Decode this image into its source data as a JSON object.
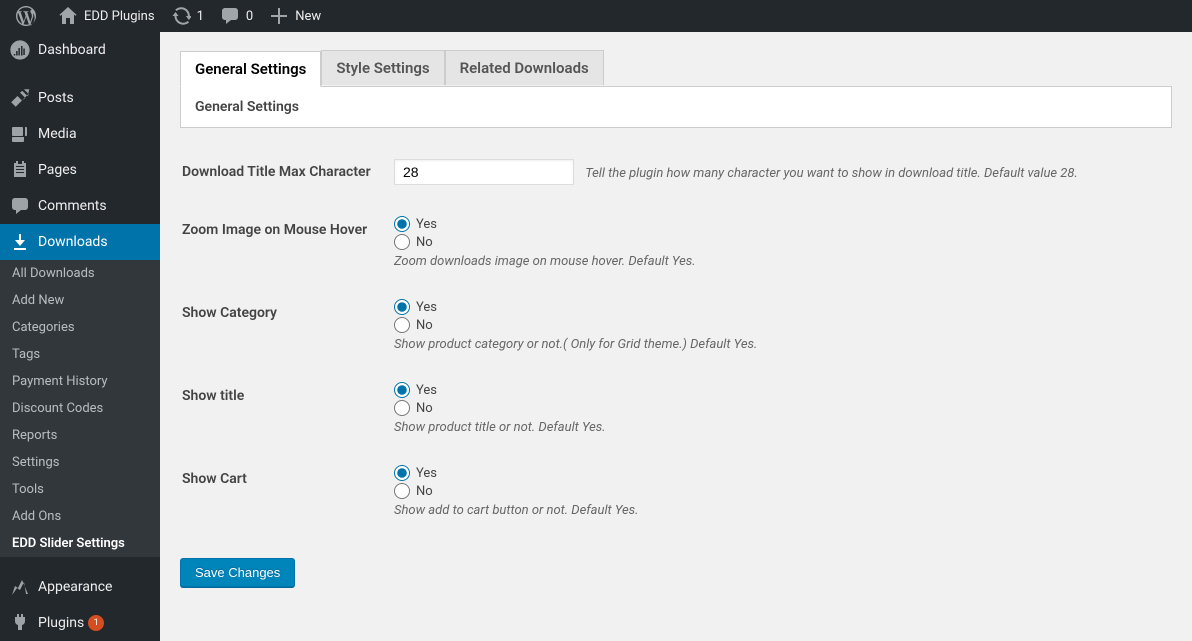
{
  "adminbar": {
    "site_name": "EDD Plugins",
    "updates_count": "1",
    "comments_count": "0",
    "new_label": "New"
  },
  "sidebar": {
    "dashboard": "Dashboard",
    "posts": "Posts",
    "media": "Media",
    "pages": "Pages",
    "comments": "Comments",
    "downloads": "Downloads",
    "downloads_sub": {
      "all": "All Downloads",
      "add_new": "Add New",
      "categories": "Categories",
      "tags": "Tags",
      "payment_history": "Payment History",
      "discount_codes": "Discount Codes",
      "reports": "Reports",
      "settings": "Settings",
      "tools": "Tools",
      "addons": "Add Ons",
      "edd_slider": "EDD Slider Settings"
    },
    "appearance": "Appearance",
    "plugins": "Plugins",
    "plugins_badge": "1"
  },
  "tabs": {
    "general": "General Settings",
    "style": "Style Settings",
    "related": "Related Downloads"
  },
  "panel_title": "General Settings",
  "fields": {
    "maxchar": {
      "label": "Download Title Max Character",
      "value": "28",
      "desc": "Tell the plugin how many character you want to show in download title. Default value 28."
    },
    "zoom": {
      "label": "Zoom Image on Mouse Hover",
      "yes": "Yes",
      "no": "No",
      "desc": "Zoom downloads image on mouse hover. Default Yes."
    },
    "category": {
      "label": "Show Category",
      "yes": "Yes",
      "no": "No",
      "desc": "Show product category or not.( Only for Grid theme.) Default Yes."
    },
    "title": {
      "label": "Show title",
      "yes": "Yes",
      "no": "No",
      "desc": "Show product title or not. Default Yes."
    },
    "cart": {
      "label": "Show Cart",
      "yes": "Yes",
      "no": "No",
      "desc": "Show add to cart button or not. Default Yes."
    }
  },
  "save_label": "Save Changes"
}
